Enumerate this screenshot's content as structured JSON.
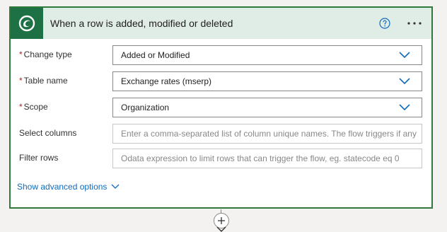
{
  "header": {
    "title": "When a row is added, modified or deleted",
    "accent_color": "#1e7145",
    "help_icon": "question-circle-icon",
    "more_icon": "ellipsis-icon",
    "logo_icon": "dataverse-logo-icon"
  },
  "fields": [
    {
      "label": "Change type",
      "required": "*",
      "value": "Added or Modified",
      "type": "dropdown"
    },
    {
      "label": "Table name",
      "required": "*",
      "value": "Exchange rates (mserp)",
      "type": "dropdown"
    },
    {
      "label": "Scope",
      "required": "*",
      "value": "Organization",
      "type": "dropdown"
    },
    {
      "label": "Select columns",
      "placeholder": "Enter a comma-separated list of column unique names. The flow triggers if any",
      "type": "text"
    },
    {
      "label": "Filter rows",
      "placeholder": "Odata expression to limit rows that can trigger the flow, eg. statecode eq 0",
      "type": "text"
    }
  ],
  "advanced": {
    "label": "Show advanced options",
    "icon": "chevron-down-icon"
  },
  "connector": {
    "icon": "plus-icon"
  }
}
